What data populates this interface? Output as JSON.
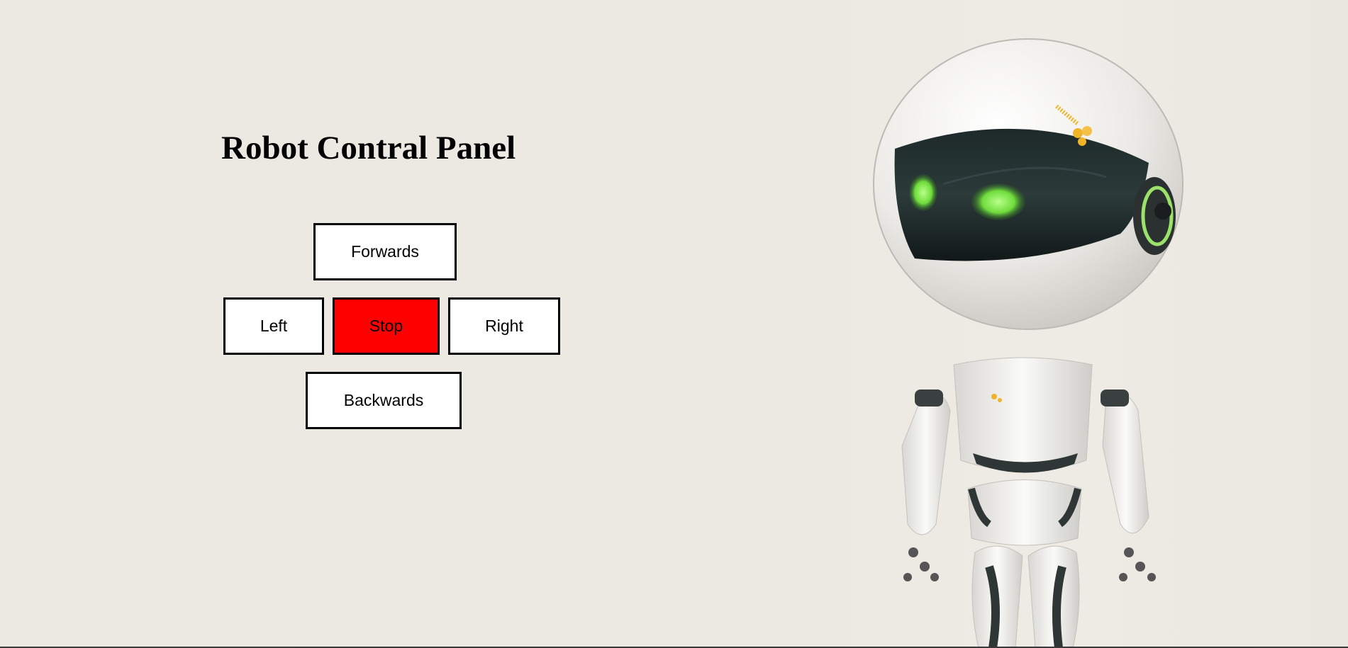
{
  "page": {
    "title": "Robot Contral Panel"
  },
  "controls": {
    "forwards_label": "Forwards",
    "left_label": "Left",
    "stop_label": "Stop",
    "right_label": "Right",
    "backwards_label": "Backwards",
    "stop_color": "#ff0000",
    "button_color": "#ffffff"
  },
  "illustration": {
    "icon": "robot-image",
    "eye_color": "#7ee04a",
    "accent_color": "#f0b429"
  }
}
